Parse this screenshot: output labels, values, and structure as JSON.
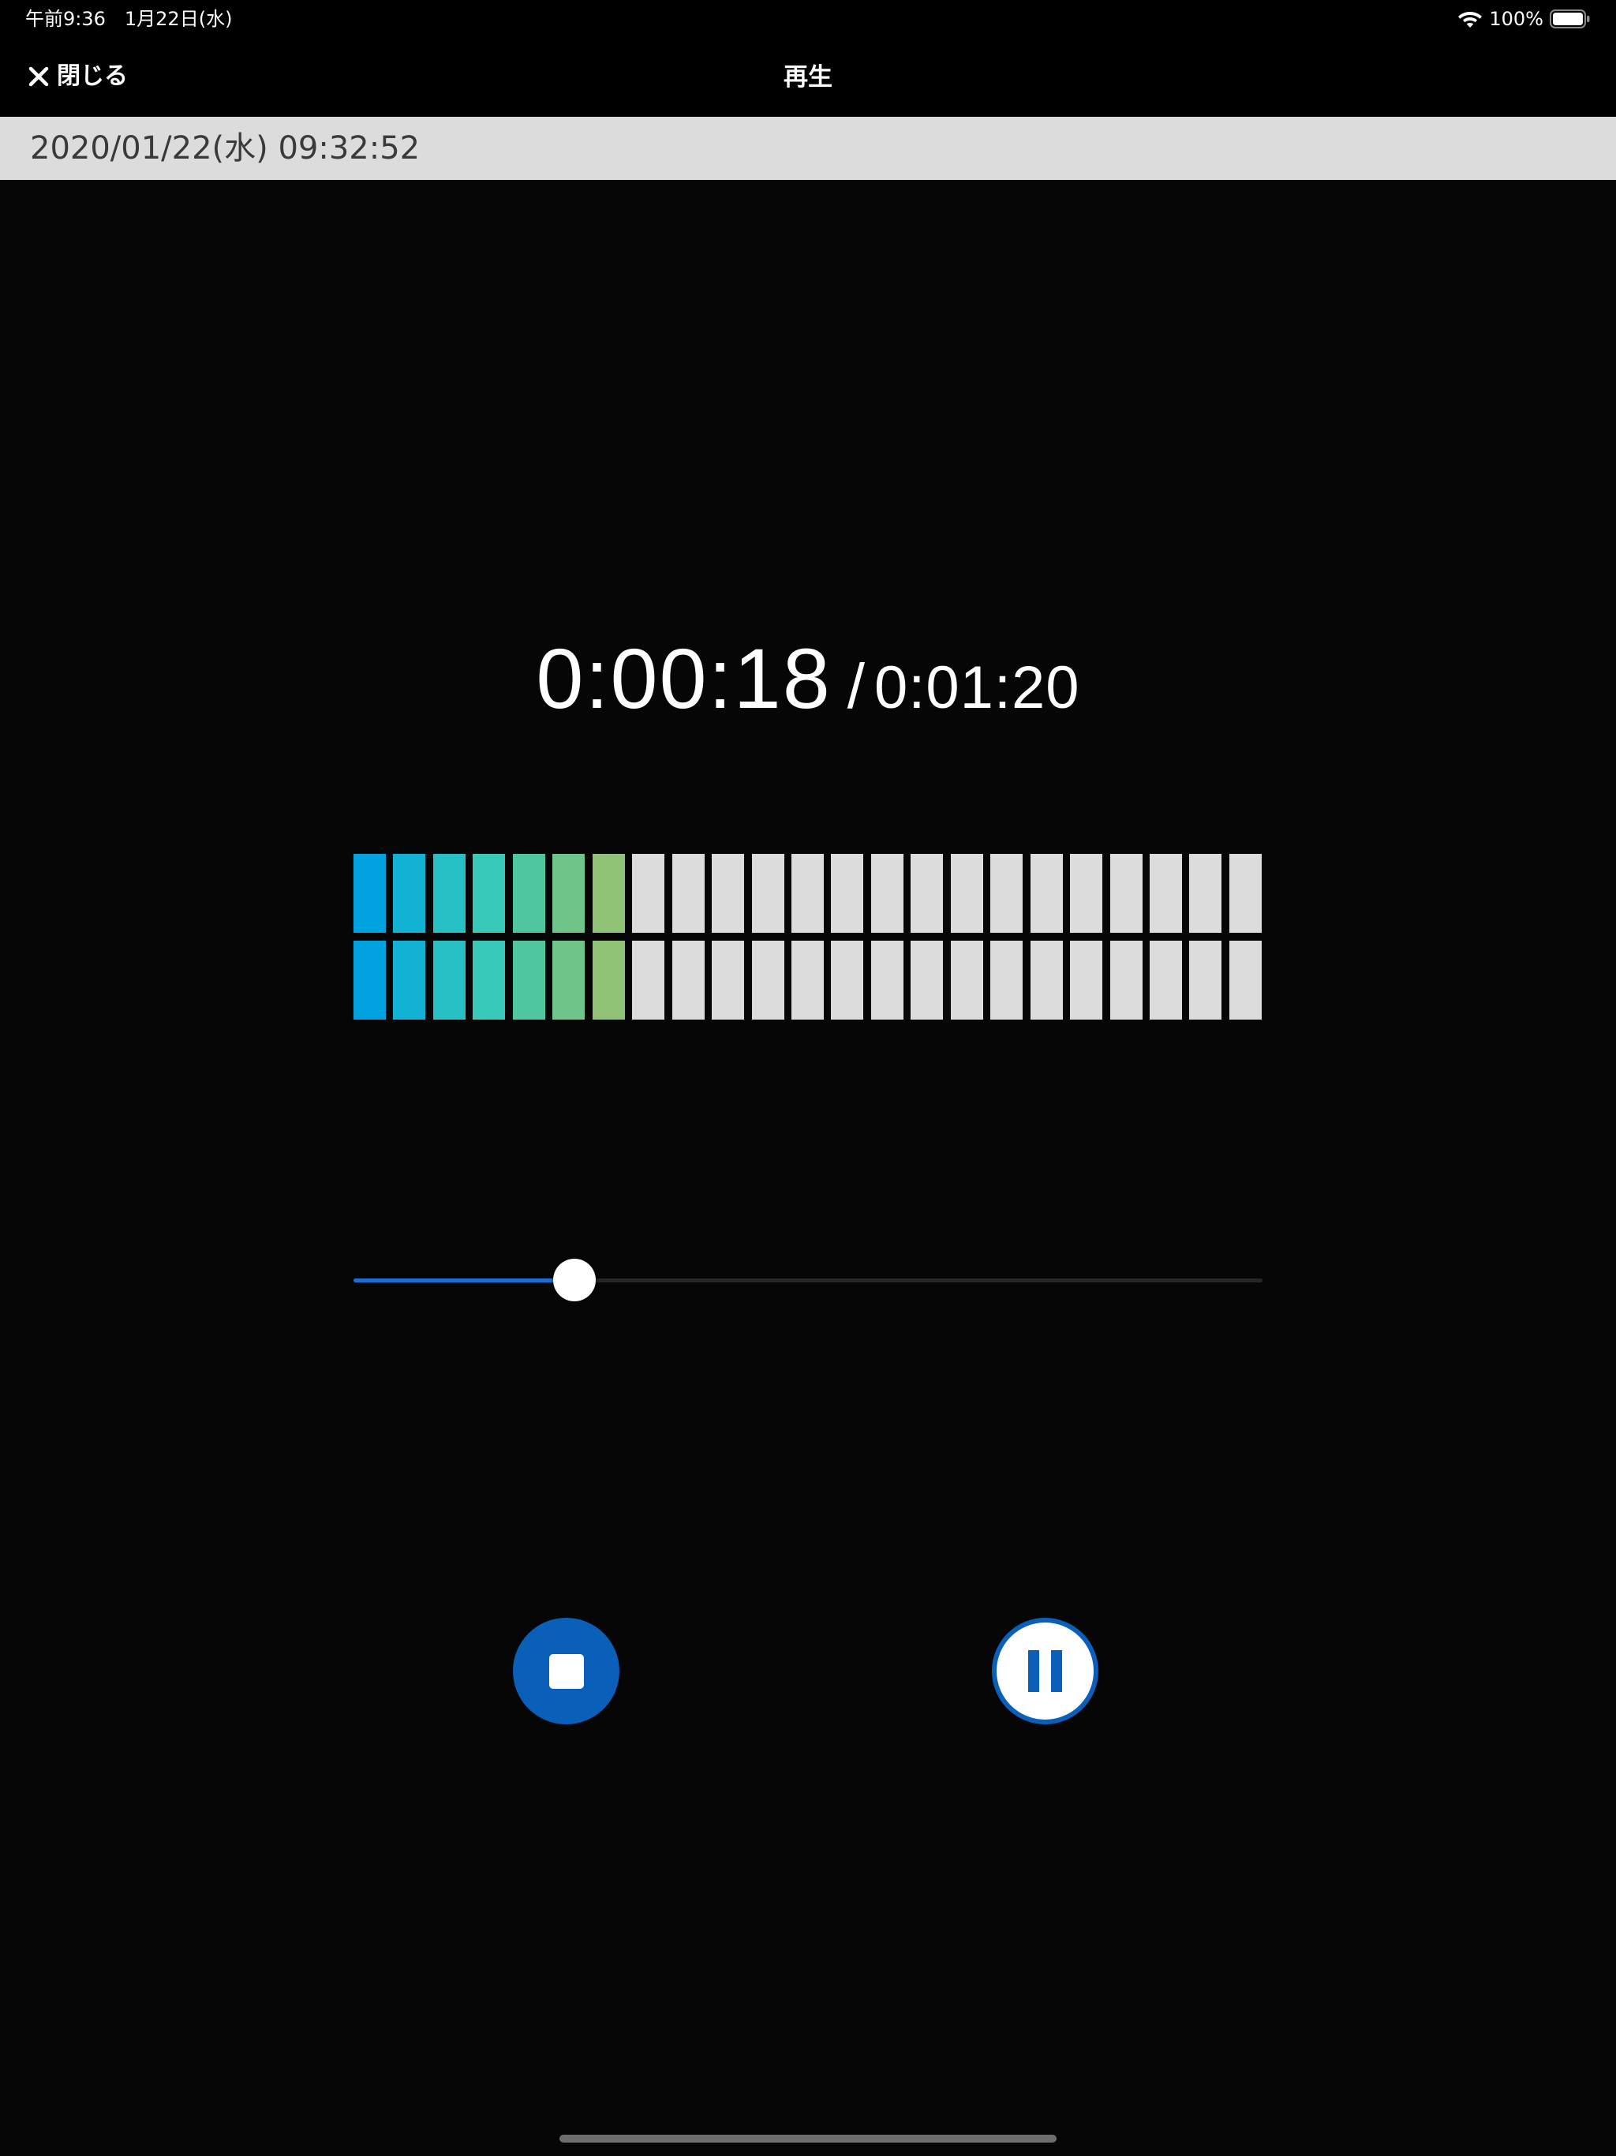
{
  "status_bar": {
    "time": "午前9:36　1月22日(水)",
    "battery": "100%",
    "icons": [
      "wifi-icon",
      "battery-icon"
    ]
  },
  "nav": {
    "close_label": "閉じる",
    "close_icon": "close-icon",
    "title": "再生"
  },
  "recording": {
    "date": "2020/01/22(水) 09:32:52"
  },
  "playback": {
    "current_time": "0:00:18",
    "separator": "/",
    "total_time": "0:01:20",
    "progress": 0.243
  },
  "level_meter": {
    "total_segments": 23,
    "channels": [
      {
        "lit_segments": 7
      },
      {
        "lit_segments": 7
      }
    ],
    "lit_colors": [
      "#00a3e0",
      "#12b2d4",
      "#27c0c5",
      "#38c9b8",
      "#4fc6a0",
      "#6fc48a",
      "#8fc274"
    ],
    "unlit_color": "#dcdcdc"
  },
  "controls": {
    "stop_icon": "stop-icon",
    "pause_icon": "pause-icon",
    "accent_color": "#0a5fb8"
  }
}
